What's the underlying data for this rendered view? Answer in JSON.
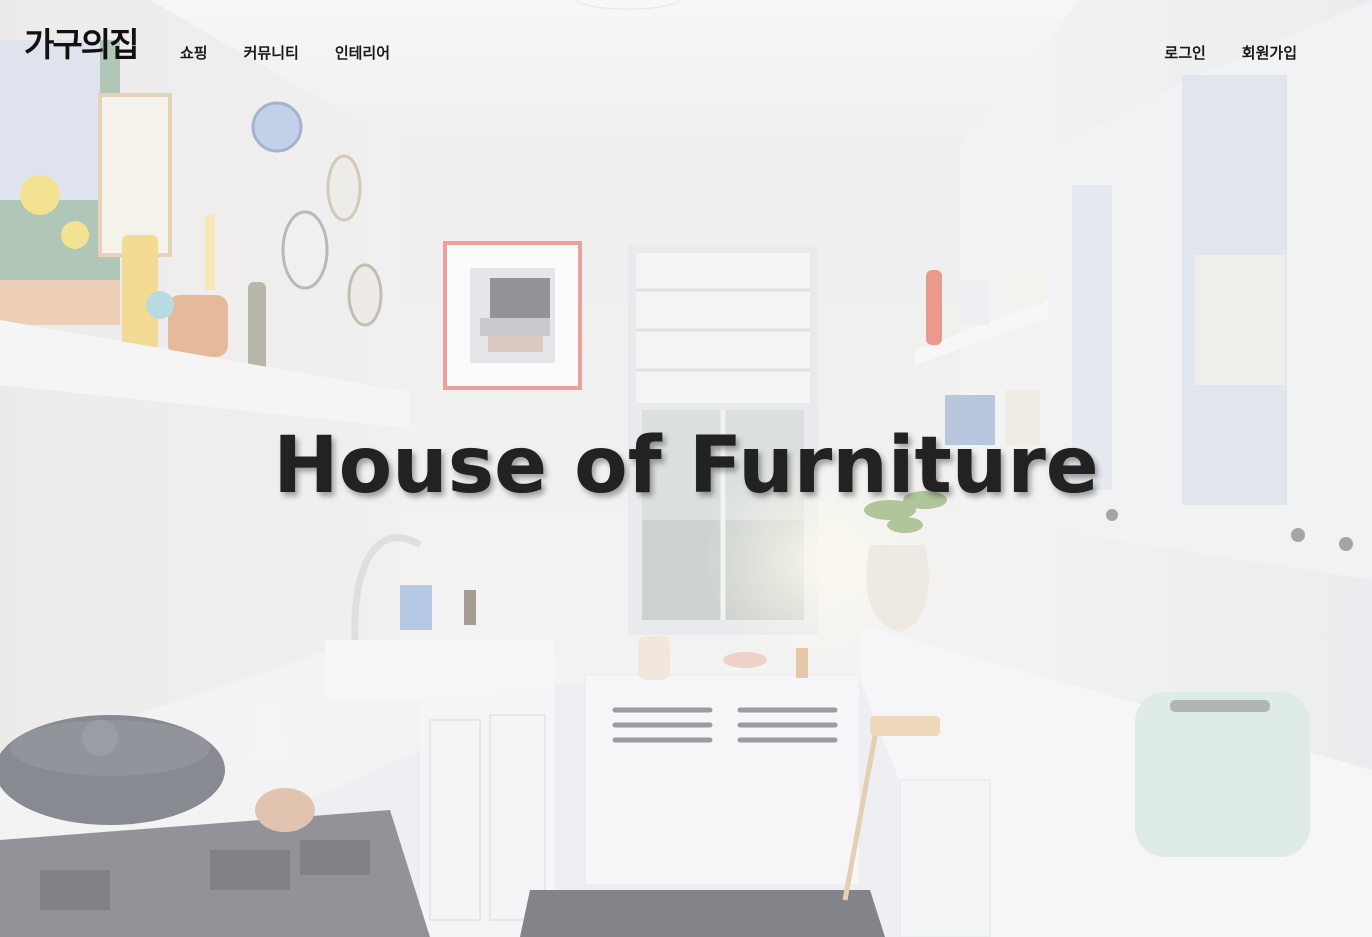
{
  "header": {
    "logo": "가구의집",
    "nav": [
      {
        "label": "쇼핑"
      },
      {
        "label": "커뮤니티"
      },
      {
        "label": "인테리어"
      }
    ],
    "auth": {
      "login": "로그인",
      "signup": "회원가입"
    }
  },
  "hero": {
    "title": "House of Furniture",
    "background": "kitchen-photo"
  },
  "colors": {
    "text": "#1a1a1a",
    "frame_accent": "#e8605a",
    "backdrop": "#e9ebee"
  }
}
